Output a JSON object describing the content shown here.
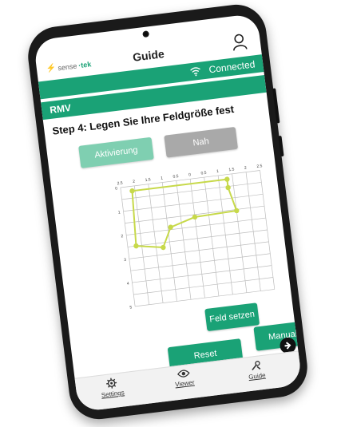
{
  "header": {
    "logo": {
      "mark": "⚡",
      "brand_part1": "sense",
      "brand_part2": "·tek"
    },
    "title": "Guide"
  },
  "status": {
    "connection": "Connected"
  },
  "section": {
    "name": "RMV"
  },
  "step": {
    "title": "Step 4: Legen Sie Ihre Feldgröße fest"
  },
  "buttons": {
    "aktivierung": "Aktivierung",
    "nah": "Nah",
    "feld_setzen": "Feld setzen",
    "reset": "Reset",
    "manual_set": "Manual Set"
  },
  "colors": {
    "accent": "#1aa276",
    "accent_light": "#7fcfb1",
    "disabled": "#a9a9a9",
    "chart_line": "#c7d94a"
  },
  "bottom_nav": [
    {
      "label": "Settings",
      "icon": "gear-icon"
    },
    {
      "label": "Viewer",
      "icon": "eye-icon"
    },
    {
      "label": "Guide",
      "icon": "tools-icon"
    }
  ],
  "chart_data": {
    "type": "line",
    "x_tick_labels": [
      "2.5",
      "2",
      "1.5",
      "1",
      "0.5",
      "0",
      "0.5",
      "1",
      "1.5",
      "2",
      "2.5"
    ],
    "y_tick_labels": [
      "0",
      "1",
      "2",
      "3",
      "4",
      "5"
    ],
    "xlim": [
      0,
      10
    ],
    "ylim": [
      0,
      10
    ],
    "grid": true,
    "series": [
      {
        "points": [
          [
            0.6,
            5
          ],
          [
            2.5,
            4.6
          ],
          [
            3.2,
            6.2
          ],
          [
            5.0,
            6.8
          ],
          [
            8.0,
            6.9
          ],
          [
            7.6,
            8.9
          ],
          [
            7.6,
            9.6
          ],
          [
            0.8,
            9.6
          ]
        ]
      }
    ]
  }
}
